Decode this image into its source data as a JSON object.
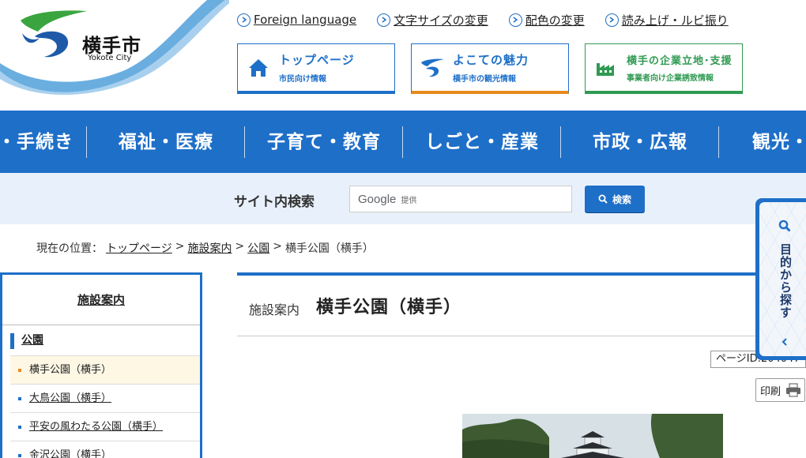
{
  "site": {
    "name": "横手市",
    "name_en": "Yokote City"
  },
  "utility_links": [
    {
      "label": "Foreign language"
    },
    {
      "label": "文字サイズの変更"
    },
    {
      "label": "配色の変更"
    },
    {
      "label": "読み上げ・ルビ振り"
    }
  ],
  "banners": [
    {
      "title": "トップページ",
      "sub": "市民向け情報",
      "icon": "house-icon"
    },
    {
      "title": "よこての魅力",
      "sub": "横手市の観光情報",
      "icon": "city-logo-icon"
    },
    {
      "title": "横手の企業立地･支援",
      "sub": "事業者向け企業誘致情報",
      "icon": "factory-icon"
    }
  ],
  "nav": [
    {
      "label": "・手続き"
    },
    {
      "label": "福祉・医療"
    },
    {
      "label": "子育て・教育"
    },
    {
      "label": "しごと・産業"
    },
    {
      "label": "市政・広報"
    },
    {
      "label": "観光・"
    }
  ],
  "search": {
    "label": "サイト内検索",
    "google": "Google",
    "provided": "提供",
    "button": "検索"
  },
  "breadcrumb": {
    "prefix": "現在の位置：",
    "items": [
      "トップページ",
      "施設案内",
      "公園"
    ],
    "separator": ">",
    "current": "横手公園（横手）"
  },
  "sidebar": {
    "title": "施設案内",
    "subtitle": "公園",
    "items": [
      {
        "label": "横手公園（横手）",
        "active": true
      },
      {
        "label": "大鳥公園（横手）",
        "active": false
      },
      {
        "label": "平安の風わたる公園（横手）",
        "active": false
      },
      {
        "label": "金沢公園（横手）",
        "active": false
      }
    ]
  },
  "main": {
    "category": "施設案内",
    "title": "横手公園（横手）"
  },
  "page_id": {
    "label": "ページID:204047"
  },
  "print": {
    "label": "印刷"
  },
  "side_tab": {
    "label": "目的から探す"
  },
  "colors": {
    "accent": "#1e6fc8",
    "orange": "#e68a1e",
    "green": "#2f9a52",
    "search_bg": "#e8f1fb"
  }
}
